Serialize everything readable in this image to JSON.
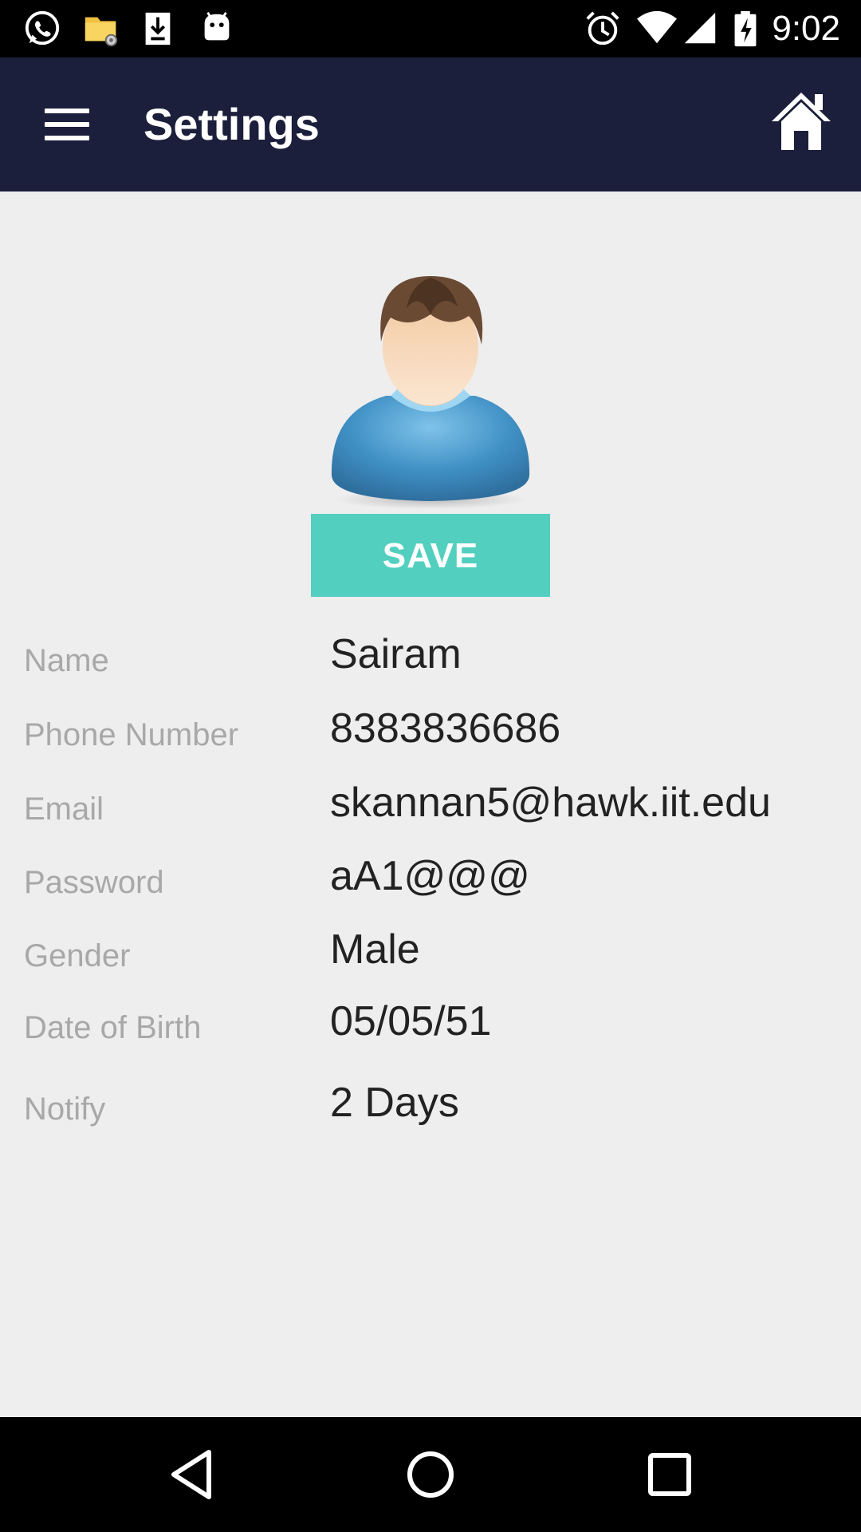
{
  "status_bar": {
    "time": "9:02",
    "icons": [
      "whatsapp-icon",
      "file-manager-icon",
      "download-icon",
      "android-icon",
      "alarm-icon",
      "wifi-icon",
      "cell-signal-icon",
      "battery-charging-icon"
    ]
  },
  "toolbar": {
    "title": "Settings",
    "menu_icon": "hamburger-menu-icon",
    "home_icon": "home-icon"
  },
  "profile": {
    "avatar": "user-avatar",
    "save_label": "SAVE"
  },
  "fields": [
    {
      "label": "Name",
      "value": "Sairam"
    },
    {
      "label": "Phone Number",
      "value": "8383836686"
    },
    {
      "label": "Email",
      "value": "skannan5@hawk.iit.edu"
    },
    {
      "label": "Password",
      "value": "aA1@@@"
    },
    {
      "label": "Gender",
      "value": "Male"
    },
    {
      "label": "Date of Birth",
      "value": "05/05/51"
    },
    {
      "label": "Notify",
      "value": "2 Days"
    }
  ],
  "nav_bar": {
    "icons": [
      "back-icon",
      "home-circle-icon",
      "recents-icon"
    ]
  },
  "colors": {
    "toolbar_bg": "#1b1f3b",
    "accent": "#52cfbf",
    "background": "#eeeeee",
    "label_text": "#a8a8a8",
    "value_text": "#222222"
  }
}
